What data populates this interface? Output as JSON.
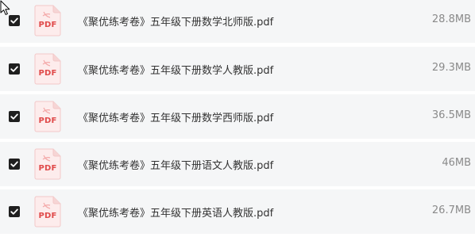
{
  "files": [
    {
      "name": "《聚优练考卷》五年级下册数学北师版.pdf",
      "size": "28.8MB",
      "checked": true,
      "icon_label": "PDF"
    },
    {
      "name": "《聚优练考卷》五年级下册数学人教版.pdf",
      "size": "29.3MB",
      "checked": true,
      "icon_label": "PDF"
    },
    {
      "name": "《聚优练考卷》五年级下册数学西师版.pdf",
      "size": "36.5MB",
      "checked": true,
      "icon_label": "PDF"
    },
    {
      "name": "《聚优练考卷》五年级下册语文人教版.pdf",
      "size": "46MB",
      "checked": true,
      "icon_label": "PDF"
    },
    {
      "name": "《聚优练考卷》五年级下册英语人教版.pdf",
      "size": "26.7MB",
      "checked": true,
      "icon_label": "PDF"
    }
  ],
  "colors": {
    "row_background": "#f5f6f7",
    "checkbox": "#1f1f1f",
    "pdf_red": "#e04a4a",
    "name_text": "#333333",
    "size_text": "#8a8a8a"
  },
  "icons": {
    "checkbox": "checkmark-icon",
    "file": "pdf-file-icon",
    "cursor": "mouse-pointer-icon"
  }
}
